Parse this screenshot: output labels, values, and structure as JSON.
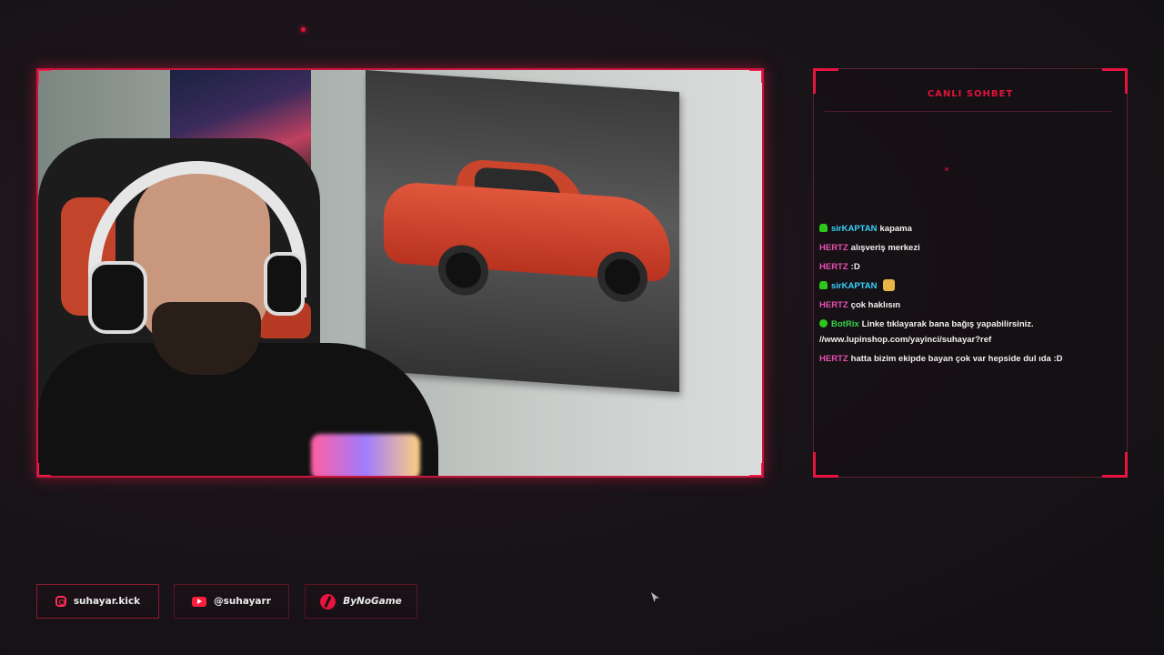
{
  "chat": {
    "title": "CANLI SOHBET",
    "messages": [
      {
        "badge": "bot",
        "user": "sirKAPTAN",
        "user_color": "#35d3ff",
        "text": "kapama"
      },
      {
        "badge": "",
        "user": "HERTZ",
        "user_color": "#e84fb2",
        "text": "alışveriş merkezi"
      },
      {
        "badge": "",
        "user": "HERTZ",
        "user_color": "#e84fb2",
        "text": ":D"
      },
      {
        "badge": "bot",
        "user": "sirKAPTAN",
        "user_color": "#35d3ff",
        "text": "",
        "emote": "emote-icon"
      },
      {
        "badge": "",
        "user": "HERTZ",
        "user_color": "#e84fb2",
        "text": "çok haklısın"
      },
      {
        "badge": "check",
        "user": "BotRix",
        "user_color": "#36d64a",
        "text": "Linke tıklayarak bana bağış yapabilirsiniz. //www.lupinshop.com/yayinci/suhayar?ref"
      },
      {
        "badge": "",
        "user": "HERTZ",
        "user_color": "#e84fb2",
        "text": "hatta bizim ekipde bayan çok var hepside dul ıda :D"
      }
    ]
  },
  "socials": {
    "instagram": "suhayar.kick",
    "youtube": "@suhayarr",
    "bynogame": "ByNoGame"
  },
  "colors": {
    "accent": "#e8143f",
    "background": "#1a1419"
  },
  "icons": [
    "instagram-icon",
    "youtube-icon",
    "bynogame-icon",
    "bot-badge-icon",
    "verified-badge-icon"
  ]
}
